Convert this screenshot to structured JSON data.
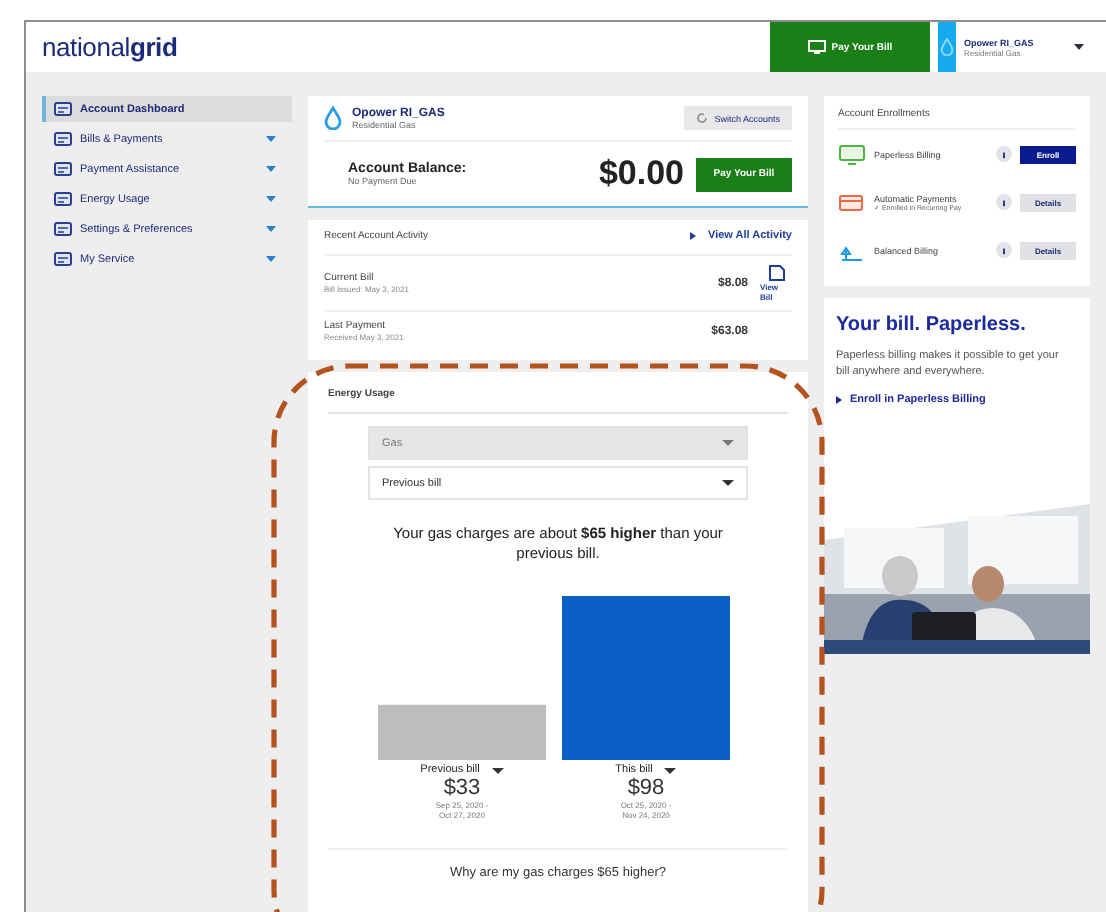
{
  "header": {
    "logo": "national**grid**",
    "pay_button": "Pay Your Bill",
    "account": {
      "name": "Opower RI_GAS",
      "type": "Residential Gas"
    }
  },
  "sidebar": {
    "items": [
      {
        "label": "Account Dashboard",
        "selected": true,
        "expandable": false
      },
      {
        "label": "Bills & Payments",
        "selected": false,
        "expandable": true
      },
      {
        "label": "Payment Assistance",
        "selected": false,
        "expandable": true
      },
      {
        "label": "Energy Usage",
        "selected": false,
        "expandable": true
      },
      {
        "label": "Settings & Preferences",
        "selected": false,
        "expandable": true
      },
      {
        "label": "My Service",
        "selected": false,
        "expandable": true
      }
    ]
  },
  "account_card": {
    "name": "Opower RI_GAS",
    "type": "Residential Gas",
    "switch_button": "Switch Accounts",
    "balance_label": "Account Balance:",
    "balance_note": "No Payment Due",
    "balance": "$0.00",
    "pay_button": "Pay Your Bill"
  },
  "activity": {
    "title": "Recent Account Activity",
    "link": "View All Activity",
    "rows": [
      {
        "label": "Current Bill",
        "date": "Bill Issued: May 3, 2021",
        "amount": "$8.08",
        "action": "View Bill"
      },
      {
        "label": "Last Payment",
        "date": "Received May 3, 2021",
        "amount": "$63.08"
      }
    ]
  },
  "energy_usage": {
    "title": "Energy Usage",
    "fuel_select": {
      "value": "Gas",
      "disabled": true
    },
    "compare_select": {
      "value": "Previous bill",
      "disabled": false
    },
    "summary": "Your gas charges are about **$65 higher** than your previous bill.",
    "chart_data": {
      "type": "bar",
      "categories": [
        "Previous bill",
        "This bill"
      ],
      "values": [
        33,
        98
      ],
      "value_labels": [
        "$33",
        "$98"
      ]
    },
    "periods": [
      {
        "start": "Sep 25, 2020 -",
        "end": "Oct 27, 2020"
      },
      {
        "start": "Oct 25, 2020 -",
        "end": "Nov 24, 2020"
      }
    ],
    "question": "Why are my gas charges $65 higher?"
  },
  "enrollments": {
    "title": "Account Enrollments",
    "items": [
      {
        "kind": "paperless",
        "label": "Paperless Billing",
        "enrolled": false,
        "button": "Enroll"
      },
      {
        "kind": "autopay",
        "label": "Automatic Payments",
        "note": "✓ Enrolled in Recurring Pay",
        "enrolled": true,
        "button": "Details"
      },
      {
        "kind": "budget",
        "label": "Balanced Billing",
        "enrolled": true,
        "button": "Details"
      }
    ]
  },
  "promo": {
    "title": "Your bill. Paperless.",
    "text": "Paperless billing makes it possible to get your bill anywhere and everywhere.",
    "link": "Enroll in Paperless Billing"
  }
}
